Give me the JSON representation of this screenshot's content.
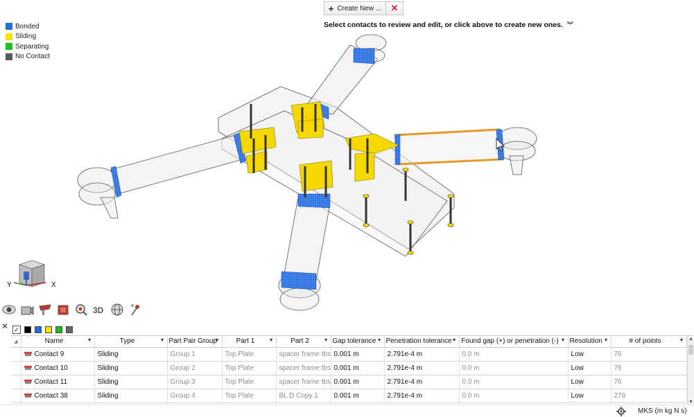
{
  "legend": [
    {
      "label": "Bonded",
      "color": "#1f6fd8"
    },
    {
      "label": "Sliding",
      "color": "#f5e400"
    },
    {
      "label": "Separating",
      "color": "#18c21d"
    },
    {
      "label": "No Contact",
      "color": "#5a5a5a"
    }
  ],
  "create_new": {
    "label": "Create New ...",
    "cancel": "✕"
  },
  "instruction": "Select contacts to review and edit, or click above to create new ones.",
  "view_cube": {
    "y_label": "Y",
    "x_label": "X"
  },
  "filter_colors": [
    "#000000",
    "#1f6fd8",
    "#f5e400",
    "#18c21d",
    "#666666"
  ],
  "table": {
    "columns": [
      "Name",
      "Type",
      "Part Pair Group",
      "Part 1",
      "Part 2",
      "Gap tolerance",
      "Penetration tolerance",
      "Found gap (+) or penetration (-)",
      "Resolution",
      "# of points"
    ],
    "rows": [
      {
        "name": "Contact 9",
        "type": "Sliding",
        "group": "Group 1",
        "part1": "Top Plate",
        "part2": "spacer frame tbs",
        "gap": "0.001 m",
        "pen": "2.791e-4 m",
        "found": "0.0 m",
        "res": "Low",
        "points": "76"
      },
      {
        "name": "Contact 10",
        "type": "Sliding",
        "group": "Group 2",
        "part1": "Top Plate",
        "part2": "spacer frame tbs",
        "gap": "0.001 m",
        "pen": "2.791e-4 m",
        "found": "0.0 m",
        "res": "Low",
        "points": "76"
      },
      {
        "name": "Contact 11",
        "type": "Sliding",
        "group": "Group 3",
        "part1": "Top Plate",
        "part2": "spacer frame tbs",
        "gap": "0.001 m",
        "pen": "2.791e-4 m",
        "found": "0.0 m",
        "res": "Low",
        "points": "76"
      },
      {
        "name": "Contact 38",
        "type": "Sliding",
        "group": "Group 4",
        "part1": "Top Plate",
        "part2": "BL D Copy 1",
        "gap": "0.001 m",
        "pen": "2.791e-4 m",
        "found": "0.0 m",
        "res": "Low",
        "points": "278"
      }
    ]
  },
  "status": {
    "units": "MKS (m kg N s)"
  }
}
